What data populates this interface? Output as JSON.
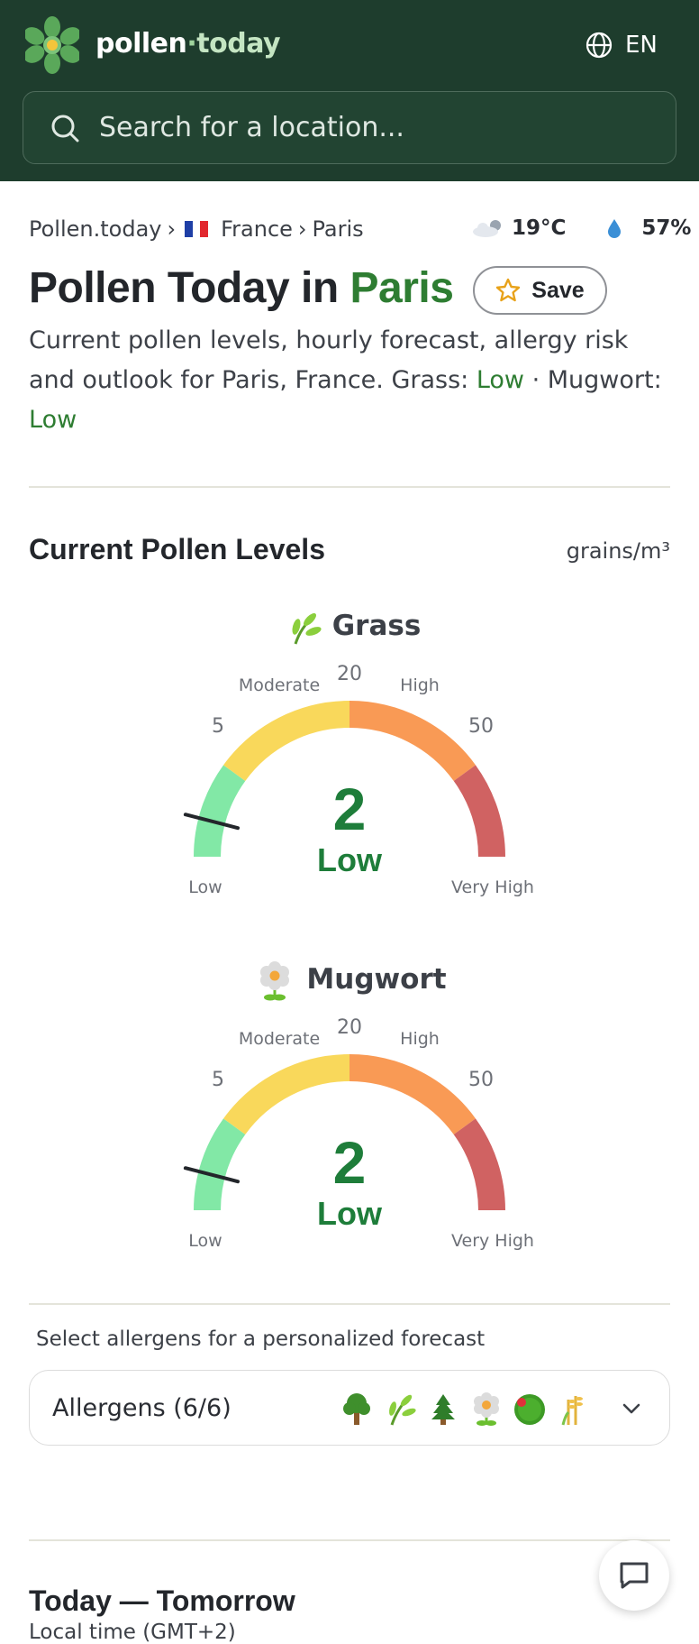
{
  "header": {
    "brand_part1": "pollen",
    "brand_sep": "·",
    "brand_part2": "today",
    "language": "EN",
    "search_placeholder": "Search for a location..."
  },
  "breadcrumb": {
    "home": "Pollen.today",
    "sep1": "›",
    "country": "France",
    "sep2": "›",
    "city": "Paris"
  },
  "weather": {
    "temperature": "19°C",
    "humidity": "57%"
  },
  "title": {
    "prefix": "Pollen Today in",
    "city": "Paris"
  },
  "save_label": "Save",
  "description": {
    "text": "Current pollen levels, hourly forecast, allergy risk and outlook for Paris, France. Grass: ",
    "grass_level": "Low",
    "mid": " · Mugwort: ",
    "mugwort_level": "Low"
  },
  "current": {
    "heading": "Current Pollen Levels",
    "units": "grains/m³",
    "gauges": [
      {
        "name": "Grass",
        "value": "2",
        "level": "Low",
        "needle_value": 2,
        "labels": {
          "low": "Low",
          "moderate": "Moderate",
          "high": "High",
          "very_high": "Very High",
          "tick_5": "5",
          "tick_20": "20",
          "tick_50": "50"
        }
      },
      {
        "name": "Mugwort",
        "value": "2",
        "level": "Low",
        "needle_value": 2,
        "labels": {
          "low": "Low",
          "moderate": "Moderate",
          "high": "High",
          "very_high": "Very High",
          "tick_5": "5",
          "tick_20": "20",
          "tick_50": "50"
        }
      }
    ]
  },
  "colors": {
    "header_bg": "#1e3d2d",
    "accent_green": "#2e7d32",
    "low": "#82e8a6",
    "moderate": "#f9d85b",
    "high": "#f99a55",
    "very_high": "#d06262"
  },
  "allergens": {
    "select_label": "Select allergens for a personalized forecast",
    "summary": "Allergens (6/6)",
    "icons": [
      "tree-icon",
      "grass-icon",
      "pine-icon",
      "mugwort-flower-icon",
      "olive-icon",
      "ragweed-icon"
    ]
  },
  "today": {
    "heading": "Today — Tomorrow",
    "local_time": "Local time (GMT+2)"
  }
}
